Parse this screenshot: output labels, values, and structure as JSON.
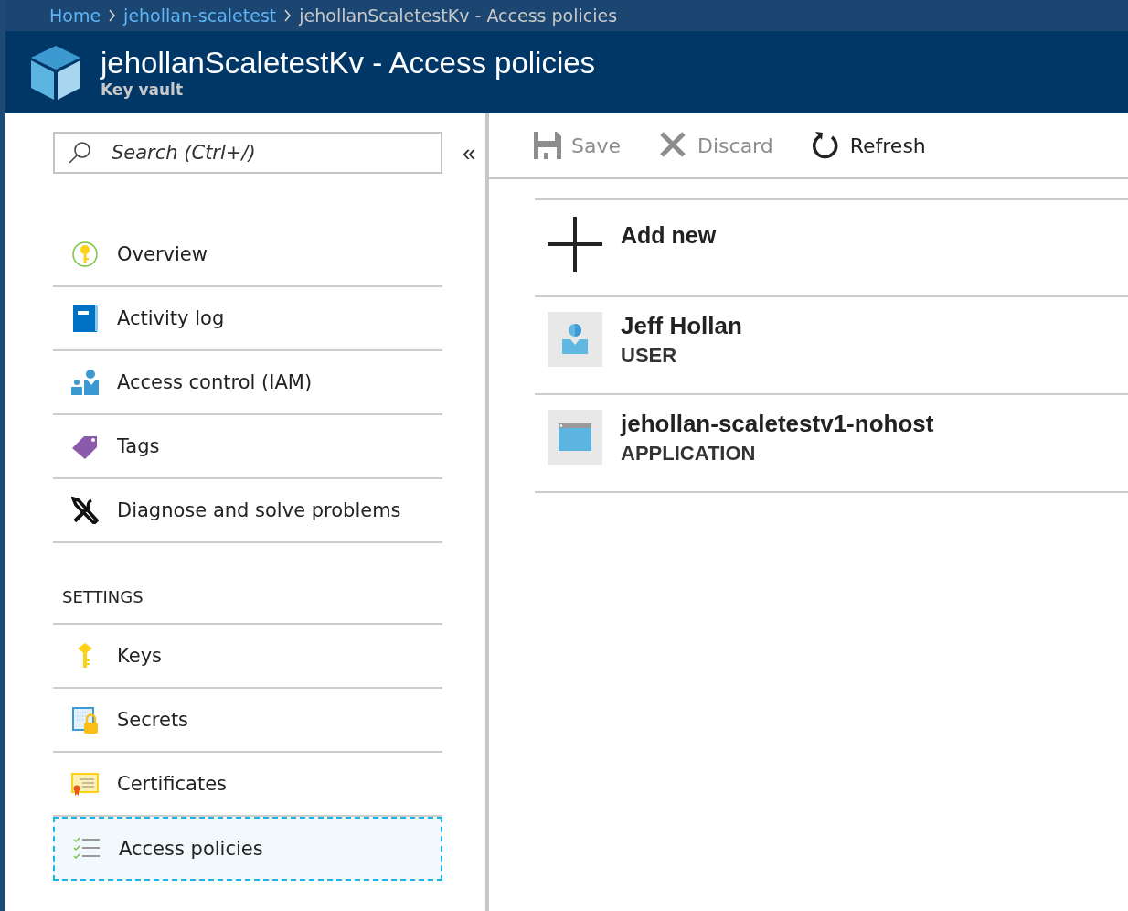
{
  "breadcrumb": [
    {
      "label": "Home",
      "kind": "link"
    },
    {
      "label": "jehollan-scaletest",
      "kind": "link"
    },
    {
      "label": "jehollanScaletestKv - Access policies",
      "kind": "current"
    }
  ],
  "header": {
    "title": "jehollanScaletestKv - Access policies",
    "subtitle": "Key vault"
  },
  "sidebar": {
    "search": {
      "placeholder": "Search (Ctrl+/)"
    },
    "collapse": "«",
    "items": [
      {
        "kind": "item",
        "label": "Overview",
        "selected": false
      },
      {
        "kind": "item",
        "label": "Activity log",
        "selected": false
      },
      {
        "kind": "item",
        "label": "Access control (IAM)",
        "selected": false
      },
      {
        "kind": "item",
        "label": "Tags",
        "selected": false
      },
      {
        "kind": "item",
        "label": "Diagnose and solve problems",
        "selected": false
      },
      {
        "kind": "header",
        "label": "SETTINGS"
      },
      {
        "kind": "item",
        "label": "Keys",
        "selected": false
      },
      {
        "kind": "item",
        "label": "Secrets",
        "selected": false
      },
      {
        "kind": "item",
        "label": "Certificates",
        "selected": false
      },
      {
        "kind": "item",
        "label": "Access policies",
        "selected": true
      }
    ]
  },
  "toolbar": [
    {
      "label": "Save",
      "disabled": true
    },
    {
      "label": "Discard",
      "disabled": true
    },
    {
      "label": "Refresh",
      "disabled": false
    }
  ],
  "policies": {
    "add_label": "Add new",
    "entries": [
      {
        "kind": "user",
        "name": "Jeff Hollan",
        "type": "USER"
      },
      {
        "kind": "application",
        "name": "jehollan-scaletestv1-nohost",
        "type": "APPLICATION"
      }
    ]
  }
}
